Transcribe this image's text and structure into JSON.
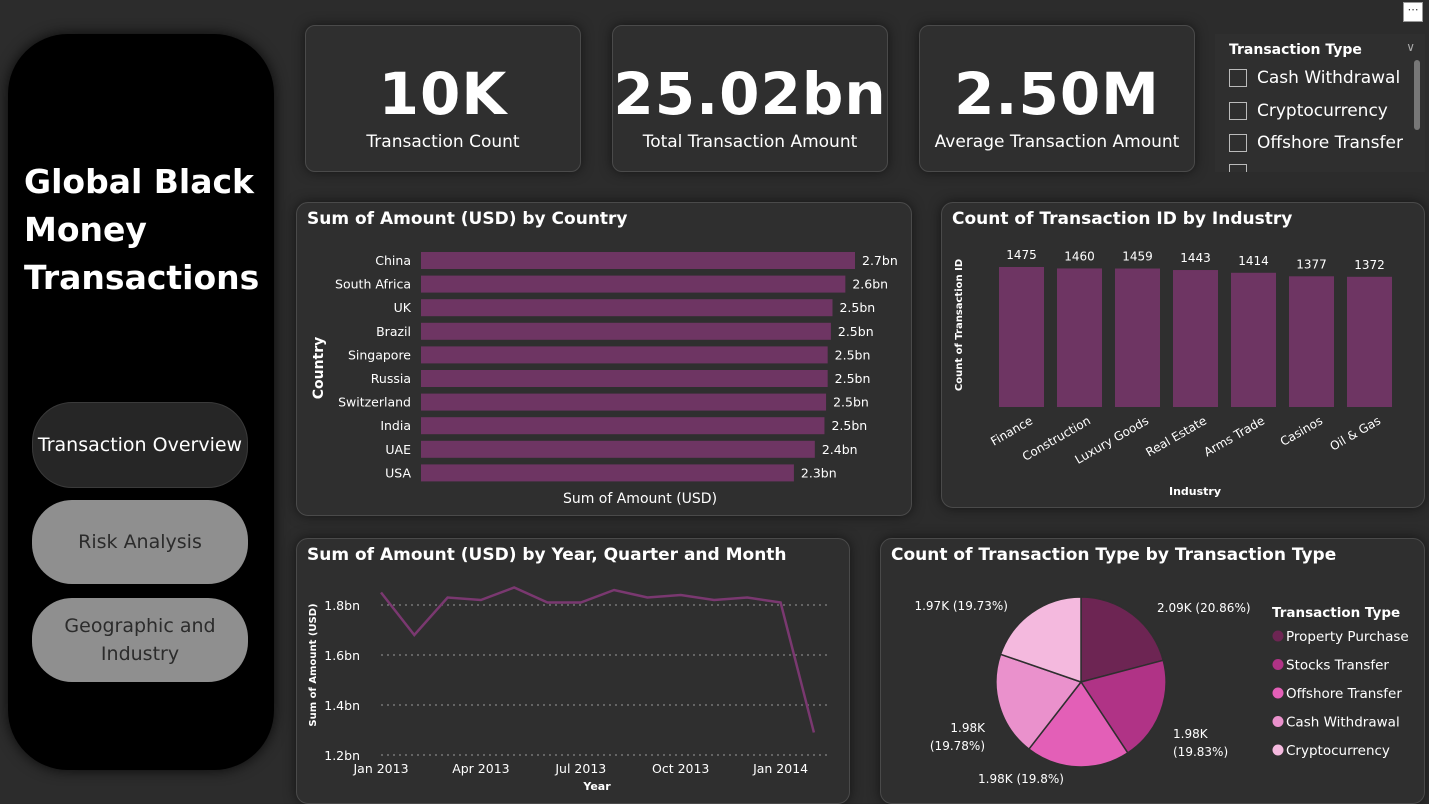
{
  "app": {
    "title": "Global Black Money Transactions",
    "more_icon": "more-options-icon"
  },
  "nav": {
    "items": [
      {
        "label": "Transaction Overview",
        "active": true
      },
      {
        "label": "Risk Analysis",
        "active": false
      },
      {
        "label": "Geographic and Industry",
        "active": false
      }
    ]
  },
  "kpis": [
    {
      "value": "10K",
      "label": "Transaction Count"
    },
    {
      "value": "25.02bn",
      "label": "Total Transaction Amount"
    },
    {
      "value": "2.50M",
      "label": "Average Transaction Amount"
    }
  ],
  "slicer": {
    "title": "Transaction Type",
    "items": [
      "Cash Withdrawal",
      "Cryptocurrency",
      "Offshore Transfer"
    ]
  },
  "colors": {
    "bar": "#6e3563",
    "line": "#7a3870",
    "pie": [
      "#6d2553",
      "#b03386",
      "#e35fb7",
      "#ea91cc",
      "#f4b9de"
    ]
  },
  "chart_data": [
    {
      "type": "bar",
      "orientation": "horizontal",
      "title": "Sum of Amount (USD) by Country",
      "xlabel": "Sum of Amount (USD)",
      "ylabel": "Country",
      "categories": [
        "China",
        "South Africa",
        "UK",
        "Brazil",
        "Singapore",
        "Russia",
        "Switzerland",
        "India",
        "UAE",
        "USA"
      ],
      "values": [
        2.7,
        2.64,
        2.56,
        2.55,
        2.53,
        2.53,
        2.52,
        2.51,
        2.45,
        2.32
      ],
      "data_labels": [
        "2.7bn",
        "2.6bn",
        "2.5bn",
        "2.5bn",
        "2.5bn",
        "2.5bn",
        "2.5bn",
        "2.5bn",
        "2.4bn",
        "2.3bn"
      ]
    },
    {
      "type": "bar",
      "orientation": "vertical",
      "title": "Count of Transaction ID by Industry",
      "xlabel": "Industry",
      "ylabel": "Count of Transaction ID",
      "categories": [
        "Finance",
        "Construction",
        "Luxury Goods",
        "Real Estate",
        "Arms Trade",
        "Casinos",
        "Oil & Gas"
      ],
      "values": [
        1475,
        1460,
        1459,
        1443,
        1414,
        1377,
        1372
      ]
    },
    {
      "type": "line",
      "title": "Sum of Amount (USD) by Year, Quarter and Month",
      "xlabel": "Year",
      "ylabel": "Sum of Amount (USD)",
      "x_ticks": [
        "Jan 2013",
        "Apr 2013",
        "Jul 2013",
        "Oct 2013",
        "Jan 2014"
      ],
      "y_ticks": [
        "1.2bn",
        "1.4bn",
        "1.6bn",
        "1.8bn"
      ],
      "ylim": [
        1.2,
        1.9
      ],
      "x": [
        "2013-01",
        "2013-02",
        "2013-03",
        "2013-04",
        "2013-05",
        "2013-06",
        "2013-07",
        "2013-08",
        "2013-09",
        "2013-10",
        "2013-11",
        "2013-12",
        "2014-01",
        "2014-02"
      ],
      "values": [
        1.85,
        1.68,
        1.83,
        1.82,
        1.87,
        1.81,
        1.81,
        1.86,
        1.83,
        1.84,
        1.82,
        1.83,
        1.81,
        1.29
      ],
      "grid": true
    },
    {
      "type": "pie",
      "title": "Count of Transaction Type by Transaction Type",
      "legend_title": "Transaction Type",
      "legend_position": "right",
      "labels": [
        "Property Purchase",
        "Stocks Transfer",
        "Offshore Transfer",
        "Cash Withdrawal",
        "Cryptocurrency"
      ],
      "values": [
        2090,
        1983,
        1980,
        1978,
        1973
      ],
      "data_labels": [
        "2.09K (20.86%)",
        "1.98K (19.83%)",
        "1.98K (19.8%)",
        "1.98K (19.78%)",
        "1.97K (19.73%)"
      ]
    }
  ]
}
